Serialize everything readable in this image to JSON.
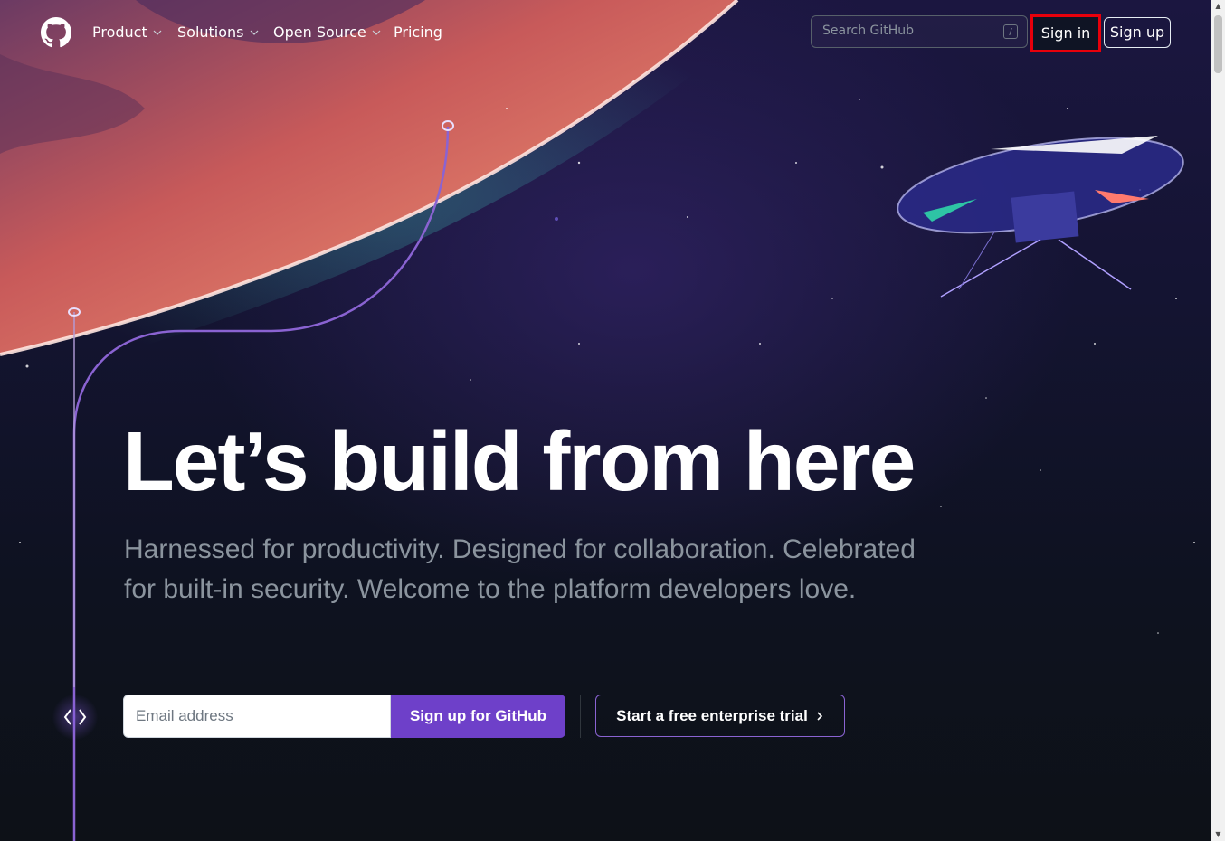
{
  "header": {
    "logo_icon": "github-mark-icon",
    "nav": [
      {
        "label": "Product",
        "has_dropdown": true
      },
      {
        "label": "Solutions",
        "has_dropdown": true
      },
      {
        "label": "Open Source",
        "has_dropdown": true
      },
      {
        "label": "Pricing",
        "has_dropdown": false
      }
    ],
    "search": {
      "placeholder": "Search GitHub",
      "shortcut": "/"
    },
    "sign_in_label": "Sign in",
    "sign_up_label": "Sign up"
  },
  "hero": {
    "title": "Let’s build from here",
    "subtitle": "Harnessed for productivity. Designed for collaboration. Celebrated for built-in security. Welcome to the platform developers love.",
    "email_placeholder": "Email address",
    "email_value": "",
    "primary_cta_label": "Sign up for GitHub",
    "secondary_cta_label": "Start a free enterprise trial",
    "secondary_cta_icon": "chevron-right-icon",
    "code_icon": "code-icon"
  },
  "colors": {
    "page_background": "#0d1117",
    "primary_button": "#6e40c9",
    "secondary_border": "#8a63d2",
    "highlight_border": "#e8000b",
    "planet": "#e07a5f",
    "timeline": "#8a63d2"
  }
}
